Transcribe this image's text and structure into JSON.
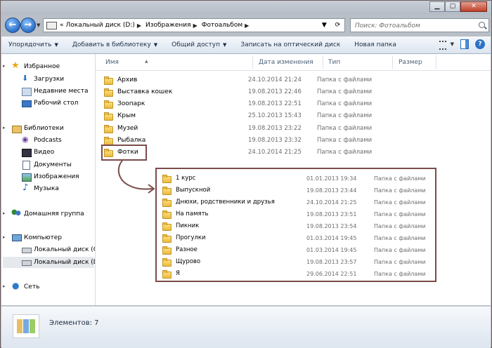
{
  "address": {
    "crumbs": [
      "Локальный диск (D:)",
      "Изображения",
      "Фотоальбом"
    ],
    "prefix_glyph": "«"
  },
  "search": {
    "placeholder": "Поиск: Фотоальбом"
  },
  "toolbar": {
    "organize": "Упорядочить",
    "add_to_library": "Добавить в библиотеку",
    "share": "Общий доступ",
    "burn": "Записать на оптический диск",
    "new_folder": "Новая папка"
  },
  "nav": {
    "favorites": "Избранное",
    "downloads": "Загрузки",
    "recent": "Недавние места",
    "desktop": "Рабочий стол",
    "libraries": "Библиотеки",
    "podcasts": "Podcasts",
    "video": "Видео",
    "documents": "Документы",
    "images": "Изображения",
    "music": "Музыка",
    "homegroup": "Домашняя группа",
    "computer": "Компьютер",
    "drive_c": "Локальный диск (C",
    "drive_d": "Локальный диск (D",
    "network": "Сеть"
  },
  "columns": {
    "name": "Имя",
    "date": "Дата изменения",
    "type": "Тип",
    "size": "Размер"
  },
  "files": [
    {
      "name": "Архив",
      "date": "24.10.2014 21:24",
      "type": "Папка с файлами"
    },
    {
      "name": "Выставка кошек",
      "date": "19.08.2013 22:46",
      "type": "Папка с файлами"
    },
    {
      "name": "Зоопарк",
      "date": "19.08.2013 22:51",
      "type": "Папка с файлами"
    },
    {
      "name": "Крым",
      "date": "25.10.2013 15:43",
      "type": "Папка с файлами"
    },
    {
      "name": "Музей",
      "date": "19.08.2013 23:22",
      "type": "Папка с файлами"
    },
    {
      "name": "Рыбалка",
      "date": "19.08.2013 23:32",
      "type": "Папка с файлами"
    },
    {
      "name": "Фотки",
      "date": "24.10.2014 21:25",
      "type": "Папка с файлами"
    }
  ],
  "popup_files": [
    {
      "name": "1 курс",
      "date": "01.01.2013 19:34",
      "type": "Папка с файлами"
    },
    {
      "name": "Выпускной",
      "date": "19.08.2013 23:44",
      "type": "Папка с файлами"
    },
    {
      "name": "Днюхи, родственники и друзья",
      "date": "24.10.2014 21:25",
      "type": "Папка с файлами"
    },
    {
      "name": "На память",
      "date": "19.08.2013 23:51",
      "type": "Папка с файлами"
    },
    {
      "name": "Пикник",
      "date": "19.08.2013 23:54",
      "type": "Папка с файлами"
    },
    {
      "name": "Прогулки",
      "date": "01.03.2014 19:45",
      "type": "Папка с файлами"
    },
    {
      "name": "Разное",
      "date": "01.03.2014 19:45",
      "type": "Папка с файлами"
    },
    {
      "name": "Щурово",
      "date": "19.08.2013 23:57",
      "type": "Папка с файлами"
    },
    {
      "name": "Я",
      "date": "29.06.2014 22:51",
      "type": "Папка с файлами"
    }
  ],
  "status": {
    "items": "Элементов: 7"
  }
}
